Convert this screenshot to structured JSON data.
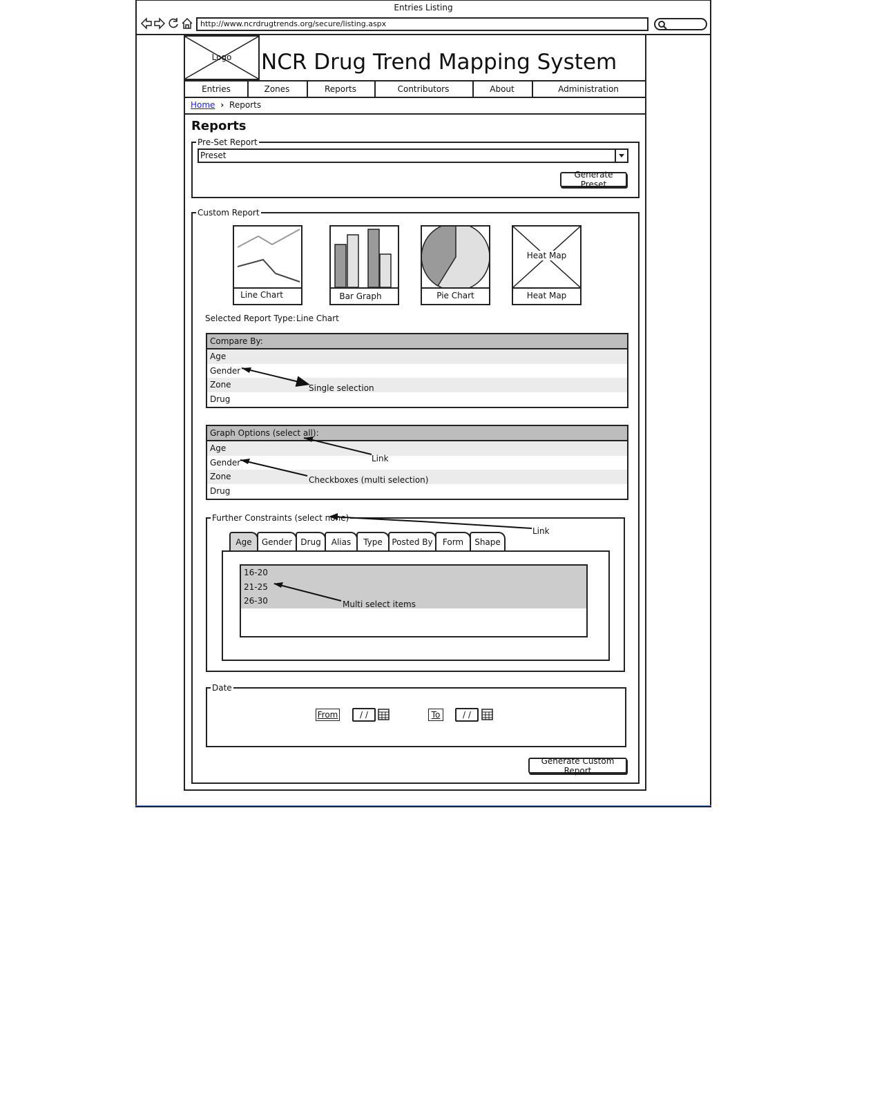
{
  "browser": {
    "window_title": "Entries Listing",
    "url": "http://www.ncrdrugtrends.org/secure/listing.aspx"
  },
  "header": {
    "logo_label": "Logo",
    "site_title": "NCR Drug Trend Mapping System"
  },
  "nav": {
    "items": [
      "Entries",
      "Zones",
      "Reports",
      "Contributors",
      "About",
      "Administration"
    ]
  },
  "breadcrumb": {
    "home": "Home",
    "current": "Reports"
  },
  "page": {
    "title": "Reports"
  },
  "preset": {
    "legend": "Pre-Set Report",
    "select_value": "Preset",
    "button": "Generate Preset"
  },
  "custom": {
    "legend": "Custom Report",
    "chart_types": [
      {
        "label": "Line Chart",
        "icon": "line-chart-icon"
      },
      {
        "label": "Bar Graph",
        "icon": "bar-graph-icon"
      },
      {
        "label": "Pie Chart",
        "icon": "pie-chart-icon"
      },
      {
        "label": "Heat Map",
        "icon": "heat-map-placeholder",
        "placeholder_text": "Heat Map"
      }
    ],
    "selected_type_label": "Selected Report Type:",
    "selected_type_value": "Line Chart",
    "compare_by": {
      "header": "Compare By:",
      "items": [
        "Age",
        "Gender",
        "Zone",
        "Drug"
      ],
      "annotation": "Single selection"
    },
    "graph_options": {
      "header": "Graph Options (select all):",
      "items": [
        "Age",
        "Gender",
        "Zone",
        "Drug"
      ],
      "annotation_link": "Link",
      "annotation_checkboxes": "Checkboxes (multi selection)"
    },
    "constraints": {
      "legend": "Further Constraints (select none)",
      "annotation_link": "Link",
      "tabs": [
        "Age",
        "Gender",
        "Drug",
        "Alias",
        "Type",
        "Posted By",
        "Form",
        "Shape"
      ],
      "items": [
        "16-20",
        "21-25",
        "26-30"
      ],
      "annotation": "Multi select items"
    },
    "date": {
      "legend": "Date",
      "from_label": "From",
      "from_value": "/ /",
      "to_label": "To",
      "to_value": "/ /"
    },
    "button": "Generate Custom Report"
  }
}
